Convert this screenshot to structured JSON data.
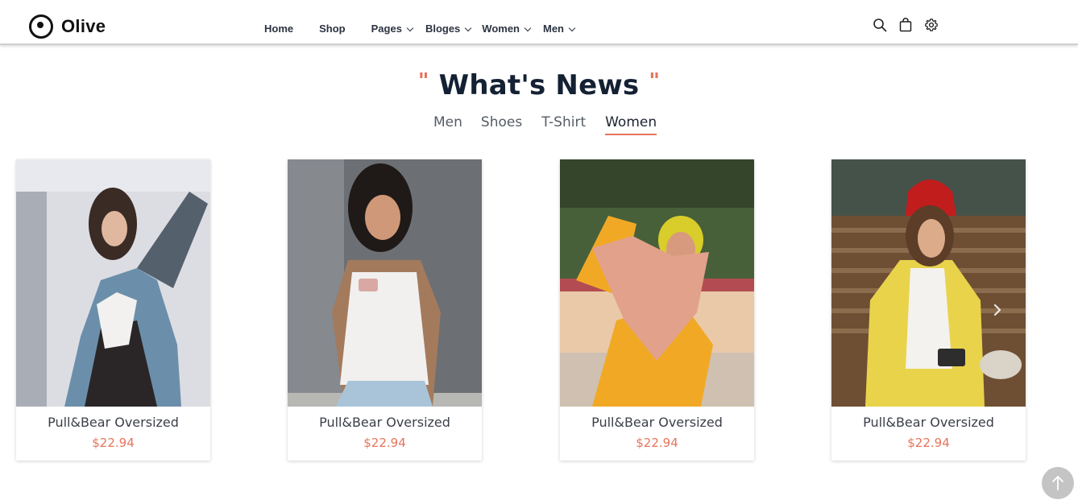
{
  "header": {
    "brand": "Olive",
    "nav": [
      {
        "label": "Home",
        "dropdown": false
      },
      {
        "label": "Shop",
        "dropdown": false
      },
      {
        "label": "Pages",
        "dropdown": true
      },
      {
        "label": "Bloges",
        "dropdown": true
      },
      {
        "label": "Women",
        "dropdown": true
      },
      {
        "label": "Men",
        "dropdown": true
      }
    ],
    "icons": [
      "search-icon",
      "shopping-bag-icon",
      "settings-gear-icon"
    ]
  },
  "section": {
    "quote_open": "\"",
    "title": "What's News",
    "quote_close": "\"",
    "tabs": [
      {
        "label": "Men",
        "active": false
      },
      {
        "label": "Shoes",
        "active": false
      },
      {
        "label": "T-Shirt",
        "active": false
      },
      {
        "label": "Women",
        "active": true
      }
    ]
  },
  "products": [
    {
      "name": "Pull&Bear Oversized",
      "price": "$22.94"
    },
    {
      "name": "Pull&Bear Oversized",
      "price": "$22.94"
    },
    {
      "name": "Pull&Bear Oversized",
      "price": "$22.94"
    },
    {
      "name": "Pull&Bear Oversized",
      "price": "$22.94"
    }
  ],
  "colors": {
    "accent": "#e6735b",
    "heading": "#142033",
    "text": "#3a3f48"
  }
}
